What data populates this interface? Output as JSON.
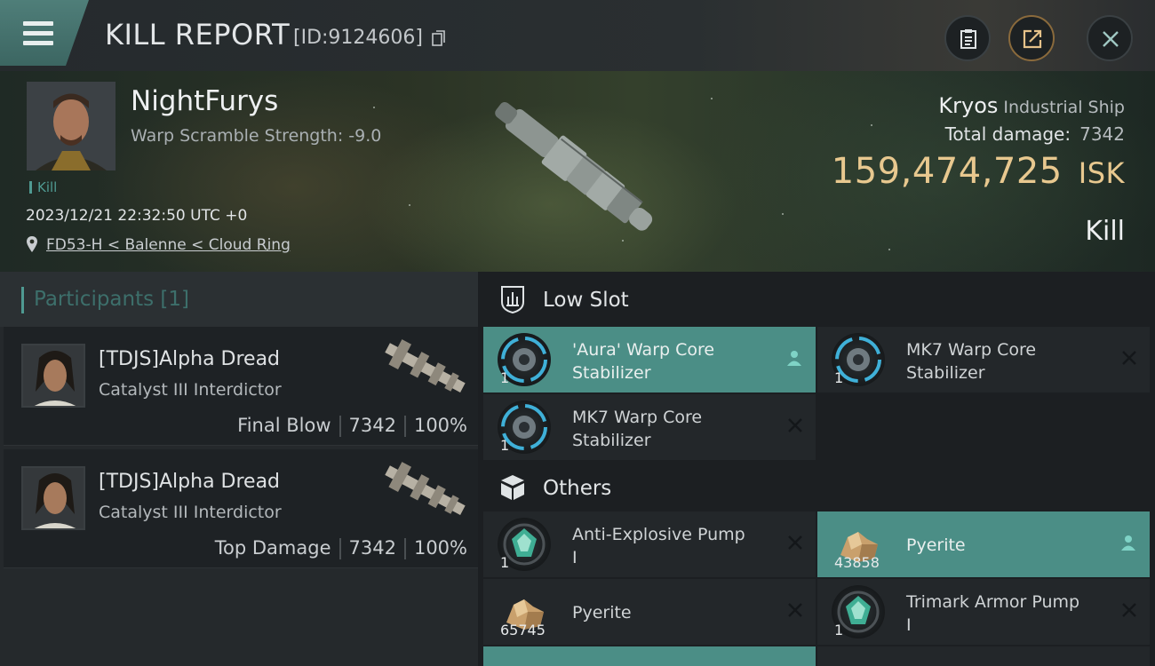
{
  "header": {
    "title": "KILL REPORT",
    "id_text": "[ID:9124606]"
  },
  "victim": {
    "name": "NightFurys",
    "stat": "Warp Scramble Strength: -9.0",
    "tag": "Kill",
    "datetime": "2023/12/21 22:32:50 UTC +0",
    "location": "FD53-H < Balenne < Cloud Ring",
    "ship_name": "Kryos",
    "ship_class": "Industrial Ship",
    "total_damage_label": "Total damage:",
    "total_damage": "7342",
    "isk_value": "159,474,725",
    "isk_unit": "ISK",
    "result": "Kill"
  },
  "participants": {
    "title": "Participants [1]",
    "rows": [
      {
        "name": "[TDJS]Alpha Dread",
        "ship": "Catalyst III Interdictor",
        "role": "Final Blow",
        "damage": "7342",
        "percent": "100%"
      },
      {
        "name": "[TDJS]Alpha Dread",
        "ship": "Catalyst III Interdictor",
        "role": "Top Damage",
        "damage": "7342",
        "percent": "100%"
      }
    ]
  },
  "sections": {
    "low_slot": "Low Slot",
    "others": "Others"
  },
  "items": {
    "low": [
      {
        "name_l1": "'Aura' Warp Core",
        "name_l2": "Stabilizer",
        "qty": "1",
        "state": "owned"
      },
      {
        "name_l1": "MK7 Warp Core",
        "name_l2": "Stabilizer",
        "qty": "1",
        "state": "destroyed"
      },
      {
        "name_l1": "MK7 Warp Core",
        "name_l2": "Stabilizer",
        "qty": "1",
        "state": "destroyed"
      }
    ],
    "others": [
      {
        "name_l1": "Anti-Explosive Pump",
        "name_l2": "I",
        "qty": "1",
        "state": "destroyed"
      },
      {
        "name_l1": "Pyerite",
        "qty": "43858",
        "state": "owned"
      },
      {
        "name_l1": "Pyerite",
        "qty": "65745",
        "state": "destroyed"
      },
      {
        "name_l1": "Trimark Armor Pump",
        "name_l2": "I",
        "qty": "1",
        "state": "destroyed"
      }
    ]
  },
  "colors": {
    "accent_teal": "#4b8e86",
    "isk_gold": "#e8c88f"
  },
  "icons": [
    "menu-icon",
    "copy-icon",
    "clipboard-icon",
    "share-icon",
    "close-icon",
    "location-pin-icon",
    "low-slot-icon",
    "cargo-box-icon",
    "warp-core-stabilizer-icon",
    "armor-pump-icon",
    "ore-icon",
    "person-icon",
    "cross-icon"
  ]
}
